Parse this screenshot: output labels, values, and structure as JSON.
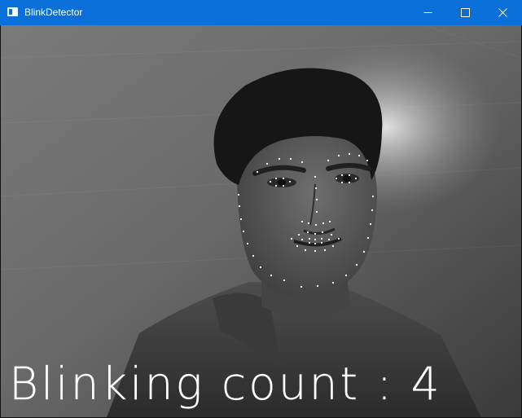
{
  "window": {
    "title": "BlinkDetector",
    "title_bar_color": "#0a6fd8",
    "icons": [
      "app-icon",
      "minimize-icon",
      "maximize-icon",
      "close-icon"
    ]
  },
  "video": {
    "mode": "grayscale webcam frame",
    "landmark_color": "#ffffff"
  },
  "overlay": {
    "blink_count_text": "Blinking count : 4"
  }
}
